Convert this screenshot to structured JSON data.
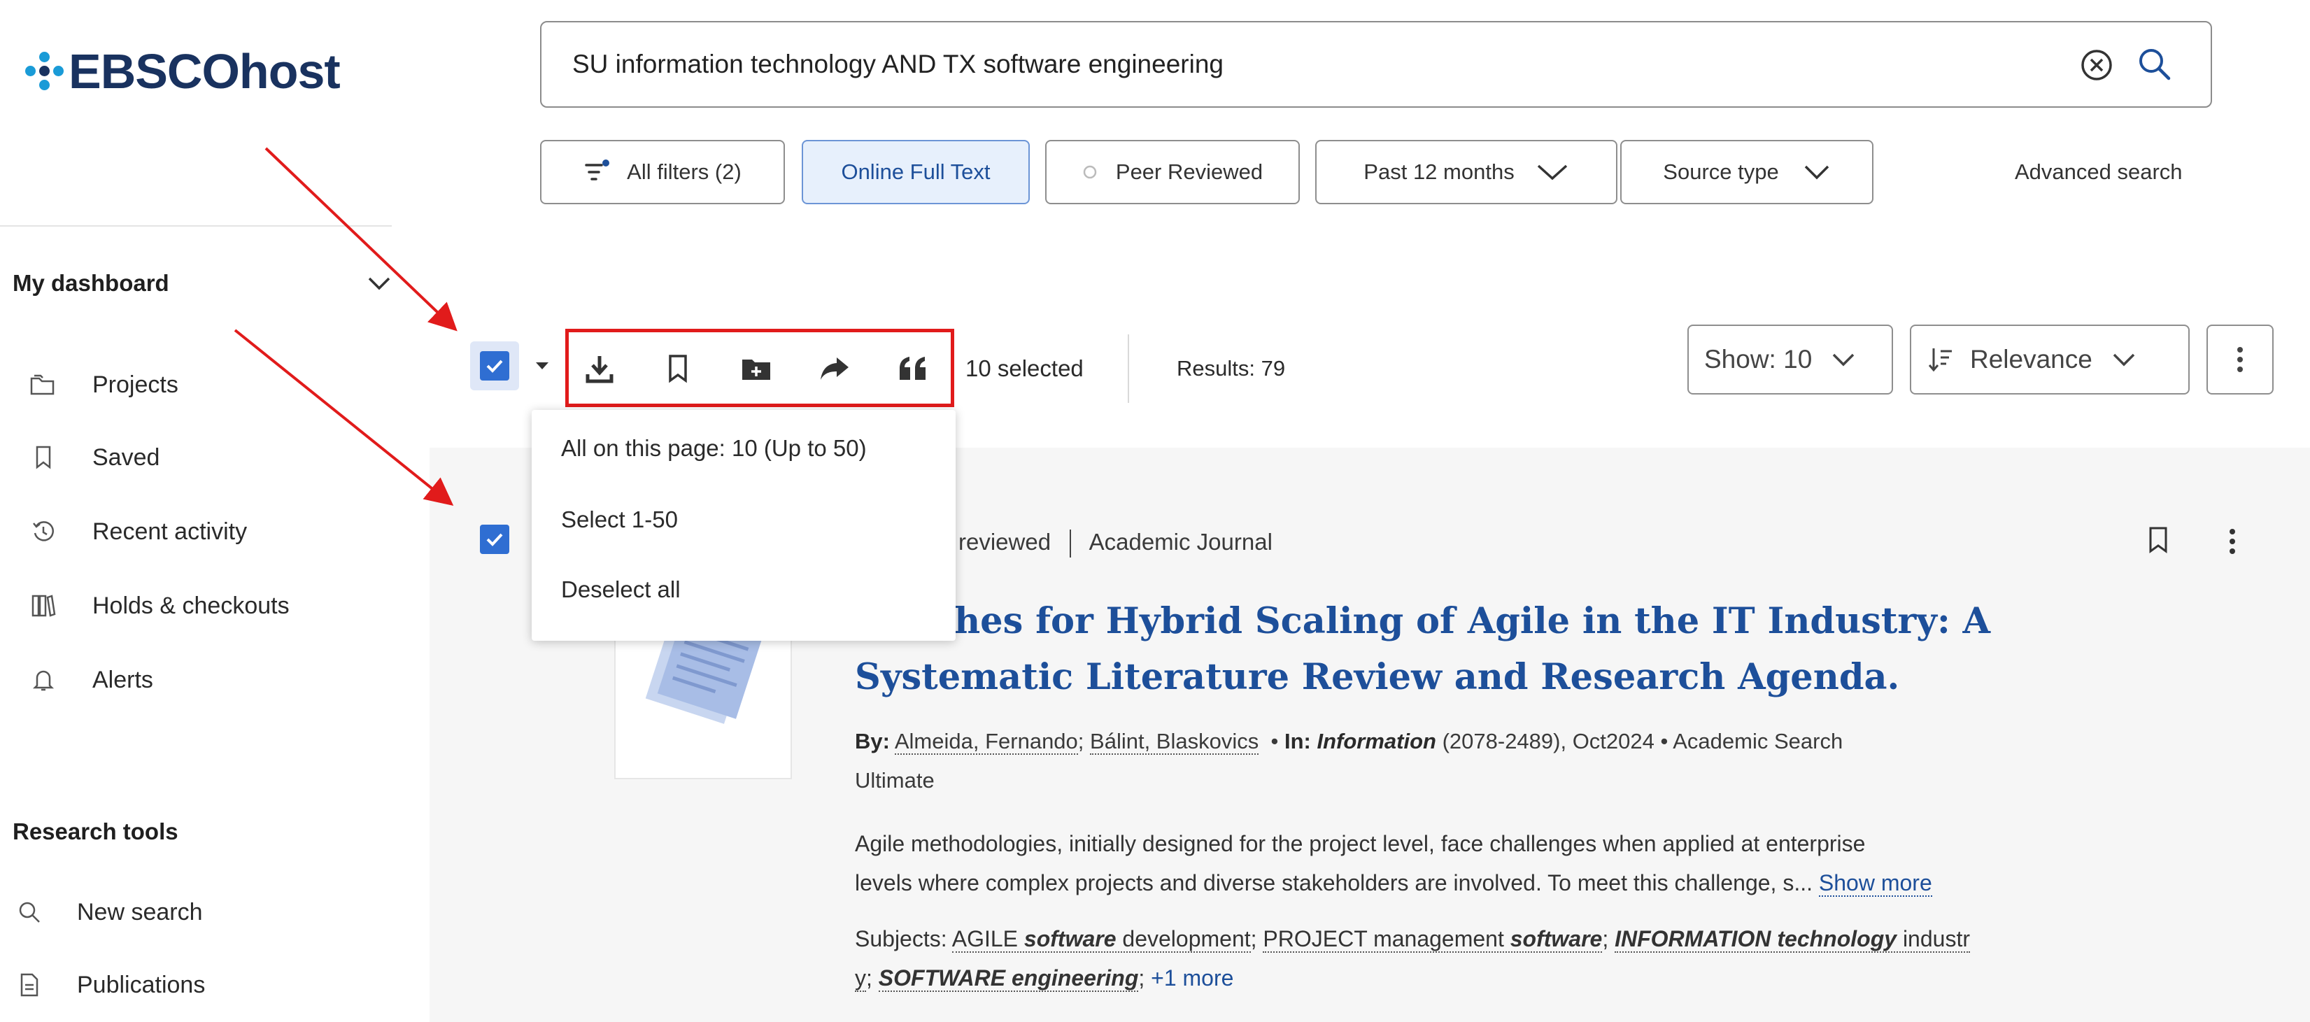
{
  "brand": {
    "name": "EBSCOhost",
    "color": "#19325f",
    "accent": "#1a9bd7"
  },
  "search": {
    "query": "SU information technology AND TX software engineering",
    "clear_icon": "circle-x-icon",
    "submit_icon": "search-icon"
  },
  "filters": {
    "all_filters": "All filters (2)",
    "online_full_text": "Online Full Text",
    "peer_reviewed": "Peer Reviewed",
    "date_range": "Past 12 months",
    "source_type": "Source type",
    "advanced_search": "Advanced search"
  },
  "sidebar": {
    "dashboard_heading": "My dashboard",
    "dashboard_items": [
      {
        "label": "Projects",
        "icon": "folders-icon"
      },
      {
        "label": "Saved",
        "icon": "bookmark-icon"
      },
      {
        "label": "Recent activity",
        "icon": "history-icon"
      },
      {
        "label": "Holds & checkouts",
        "icon": "books-icon"
      },
      {
        "label": "Alerts",
        "icon": "bell-icon"
      }
    ],
    "tools_heading": "Research tools",
    "tools_items": [
      {
        "label": "New search",
        "icon": "search-icon"
      },
      {
        "label": "Publications",
        "icon": "document-icon"
      }
    ]
  },
  "toolbar": {
    "selected_count": "10 selected",
    "results": "Results: 79",
    "show": "Show: 10",
    "sort": "Relevance",
    "actions": [
      "download-icon",
      "bookmark-icon",
      "folder-add-icon",
      "share-icon",
      "cite-icon"
    ]
  },
  "select_menu": {
    "items": [
      "All on this page: 10 (Up to 50)",
      "Select 1-50",
      "Deselect all"
    ]
  },
  "result": {
    "meta_peer": "reviewed",
    "meta_type": "Academic Journal",
    "title_line1": "aches for Hybrid Scaling of Agile in the IT Industry: A",
    "title_line2": "Systematic Literature Review and Research Agenda.",
    "by_label": "By:",
    "author1": "Almeida, Fernando",
    "author2": "Bálint, Blaskovics",
    "in_label": "In:",
    "journal": "Information",
    "journal_info": "(2078-2489), Oct2024 • Academic Search",
    "database_cont": "Ultimate",
    "abstract_line1": "Agile methodologies, initially designed for the project level, face challenges when applied at enterprise",
    "abstract_line2": "levels where complex projects and diverse stakeholders are involved. To meet this challenge, s...",
    "show_more": "Show more",
    "subjects_label": "Subjects:",
    "subject1a": "AGILE",
    "subject1b": "software",
    "subject1c": "development",
    "subject2a": "PROJECT management",
    "subject2b": "software",
    "subject3a": "INFORMATION technology",
    "subject3b": "industr",
    "subject3c": "y",
    "subject4": "SOFTWARE engineering",
    "more": "+1 more"
  },
  "colors": {
    "annotation_red": "#e11b1b",
    "link_blue": "#1d4f9a",
    "checkbox_blue": "#2f6ed2"
  }
}
